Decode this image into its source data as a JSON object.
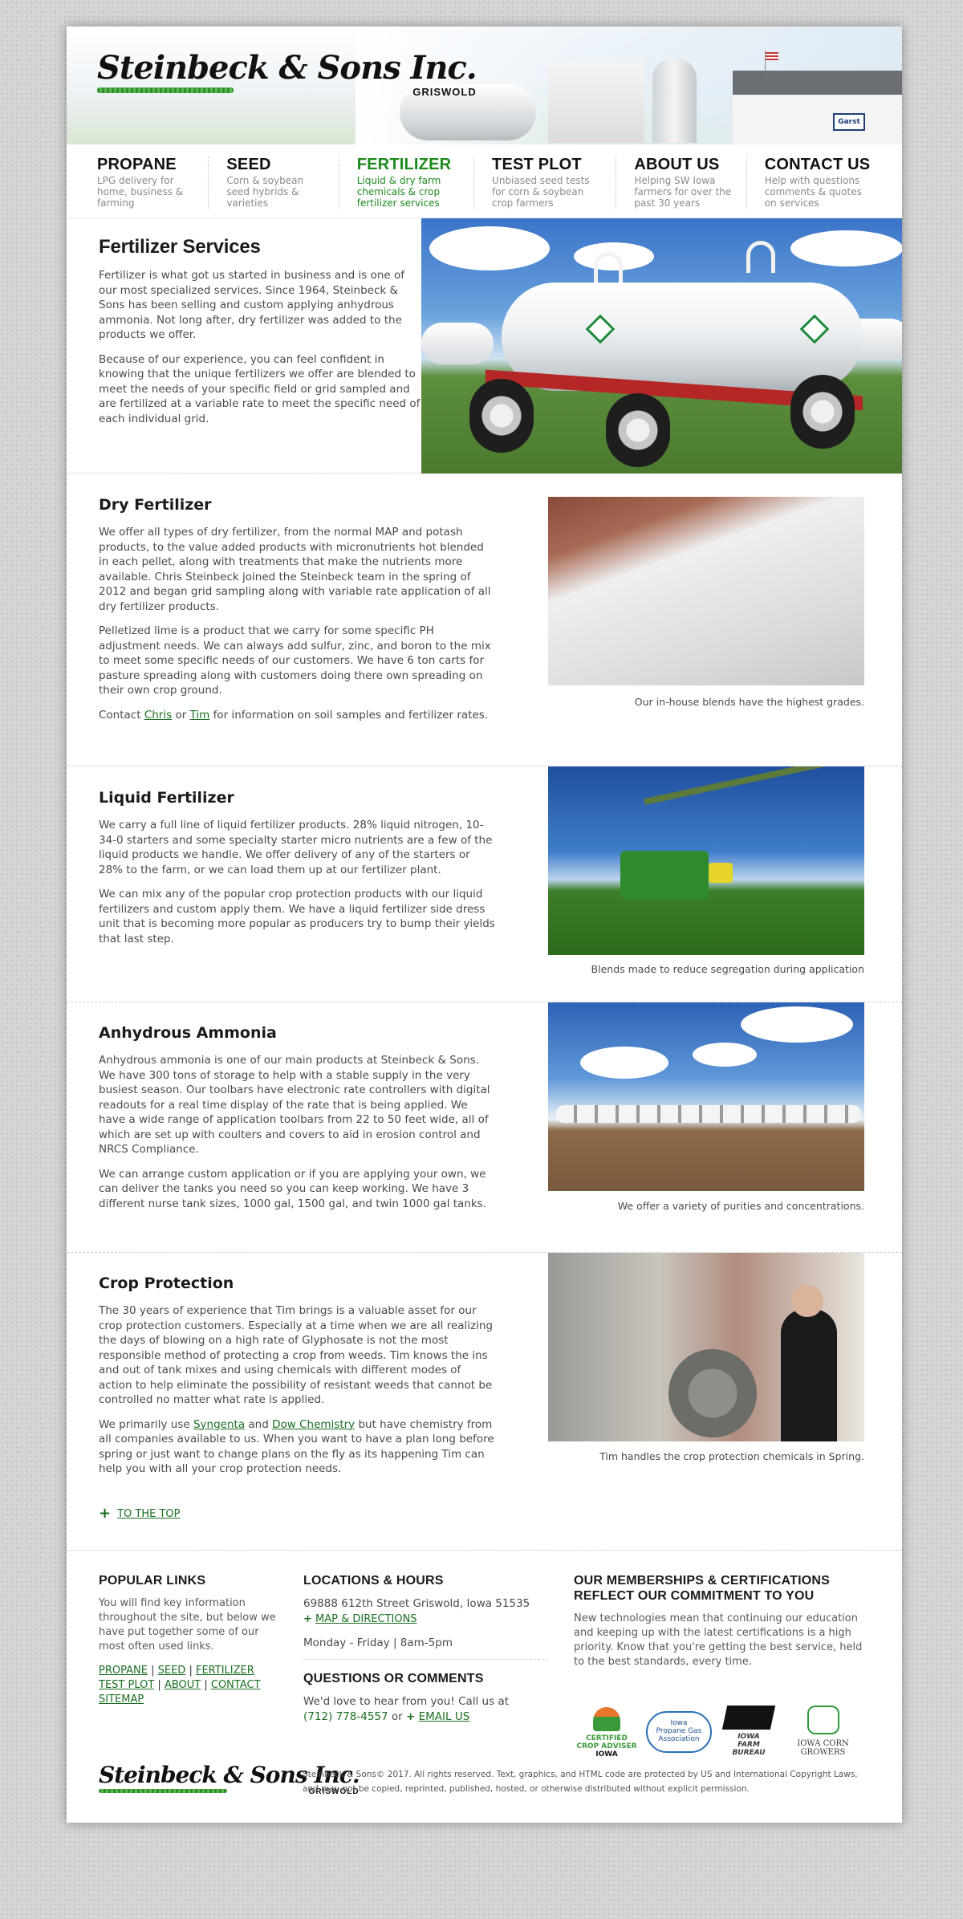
{
  "brand": {
    "name": "Steinbeck & Sons Inc.",
    "location": "GRISWOLD",
    "sign": "Garst"
  },
  "nav": [
    {
      "title": "PROPANE",
      "desc": "LPG delivery for home, business & farming",
      "active": false
    },
    {
      "title": "SEED",
      "desc": "Corn & soybean seed hybrids & varieties",
      "active": false
    },
    {
      "title": "FERTILIZER",
      "desc": "Liquid & dry farm chemicals & crop fertilizer services",
      "active": true
    },
    {
      "title": "TEST PLOT",
      "desc": "Unbiased seed tests for corn & soybean crop farmers",
      "active": false
    },
    {
      "title": "ABOUT US",
      "desc": "Helping SW Iowa farmers for over the past 30 years",
      "active": false
    },
    {
      "title": "CONTACT US",
      "desc": "Help with questions comments & quotes on services",
      "active": false
    }
  ],
  "hero": {
    "title": "Fertilizer Services",
    "p1": "Fertilizer is what got us started in business and is one of our most specialized services. Since 1964, Steinbeck & Sons has been selling and custom applying anhydrous ammonia. Not long after, dry fertilizer was added to the products we offer.",
    "p2": "Because of our experience, you can feel confident in knowing that the unique fertilizers we offer are blended to meet the needs of your specific field or grid sampled and are fertilized at a variable rate to meet the specific need of each individual grid."
  },
  "dry": {
    "title": "Dry Fertilizer",
    "p1": "We offer all types of dry fertilizer, from the normal MAP and potash products, to the value added products with micronutrients hot blended in each pellet, along with treatments that make the nutrients more available. Chris Steinbeck joined the Steinbeck team in the spring of 2012 and began grid sampling along with variable rate application of all dry fertilizer products.",
    "p2": "Pelletized lime is a product that we carry for some specific PH adjustment needs. We can always add sulfur, zinc, and boron to the mix to meet some specific needs of our customers. We have 6 ton carts for pasture spreading along with customers doing there own spreading on their own crop ground.",
    "contact_prefix": "Contact",
    "contact_link1": "Chris",
    "contact_or": "or",
    "contact_link2": "Tim",
    "contact_suffix": "for information on soil samples and fertilizer rates.",
    "caption": "Our in-house blends have the highest grades."
  },
  "liquid": {
    "title": "Liquid Fertilizer",
    "p1": "We carry a full line of liquid fertilizer products. 28% liquid nitrogen, 10-34-0 starters and some specialty starter micro nutrients are a few of the liquid products we handle. We offer delivery of any of the starters or 28% to the farm, or we can load them up at our fertilizer plant.",
    "p2": "We can mix any of the popular crop protection products with our liquid fertilizers and custom apply them. We have a liquid fertilizer side dress unit that is becoming more popular as producers try to bump their yields that last step.",
    "caption": "Blends made to reduce segregation during application"
  },
  "ammonia": {
    "title": "Anhydrous Ammonia",
    "p1": "Anhydrous ammonia is one of our main products at Steinbeck & Sons. We have 300 tons of storage to help with a stable supply in the very busiest season. Our toolbars have electronic rate controllers with digital readouts for a real time display of the rate that is being applied. We have a wide range of application toolbars from 22 to 50 feet wide, all of which are set up with coulters and covers to aid in erosion control and NRCS Compliance.",
    "p2": "We can arrange custom application or if you are applying your own, we can deliver the tanks you need so you can keep working. We have 3 different nurse tank sizes, 1000 gal, 1500 gal, and twin 1000 gal tanks.",
    "caption": "We offer a variety of purities and concentrations."
  },
  "crop": {
    "title": "Crop Protection",
    "p1": "The 30 years of experience that Tim brings is a valuable asset for our crop protection customers. Especially at a time when we are all realizing the days of blowing on a high rate of Glyphosate is not the most responsible method of protecting a crop from weeds. Tim knows the ins and out of tank mixes and using chemicals with different modes of action to help eliminate the possibility of resistant weeds that cannot be controlled no matter what rate is applied.",
    "p2_prefix": "We primarily use",
    "p2_link1": "Syngenta",
    "p2_and": "and",
    "p2_link2": "Dow Chemistry",
    "p2_suffix": "but have chemistry from all companies available to us. When you want to have a plan long before spring or just want to change plans on the fly as its happening Tim can help you with all your crop protection needs.",
    "caption": "Tim handles the crop protection chemicals in Spring."
  },
  "to_top": {
    "icon": "+",
    "label": "TO THE TOP"
  },
  "footer": {
    "popular": {
      "title": "POPULAR LINKS",
      "text": "You will find key information throughout the site, but below we have put together some of our most often used links.",
      "links": [
        "PROPANE",
        "SEED",
        "FERTILIZER",
        "TEST PLOT",
        "ABOUT",
        "CONTACT",
        "SITEMAP"
      ]
    },
    "locations": {
      "title": "LOCATIONS & HOURS",
      "address": "69888 612th Street Griswold, Iowa 51535",
      "map_link": "MAP & DIRECTIONS",
      "hours": "Monday - Friday | 8am-5pm"
    },
    "questions": {
      "title": "QUESTIONS OR COMMENTS",
      "text": "We'd love to hear from you! Call us at",
      "phone": "(712) 778-4557",
      "or": "or",
      "email_link": "EMAIL US"
    },
    "memberships": {
      "title": "OUR MEMBERSHIPS & CERTIFICATIONS REFLECT OUR COMMITMENT TO YOU",
      "text": "New technologies mean that continuing our education and keeping up with the latest certifications is a high priority. Know that you're getting the best service, held to the best standards, every time.",
      "logos": [
        {
          "line1": "CERTIFIED",
          "line2": "CROP ADVISER",
          "line3": "IOWA"
        },
        {
          "line1": "Iowa",
          "line2": "Propane Gas",
          "line3": "Association"
        },
        {
          "line1": "IOWA",
          "line2": "FARM",
          "line3": "BUREAU"
        },
        {
          "line1": "IOWA CORN",
          "line2": "GROWERS",
          "line3": ""
        }
      ]
    },
    "copyright": "Steinbeck & Sons© 2017. All rights reserved. Text, graphics, and HTML code are protected by US and International Copyright Laws, and may not be copied, reprinted, published, hosted, or otherwise distributed without explicit permission."
  },
  "colors": {
    "accent": "#1d8a1d",
    "link": "#1b6e22",
    "frame": "#b52626"
  }
}
